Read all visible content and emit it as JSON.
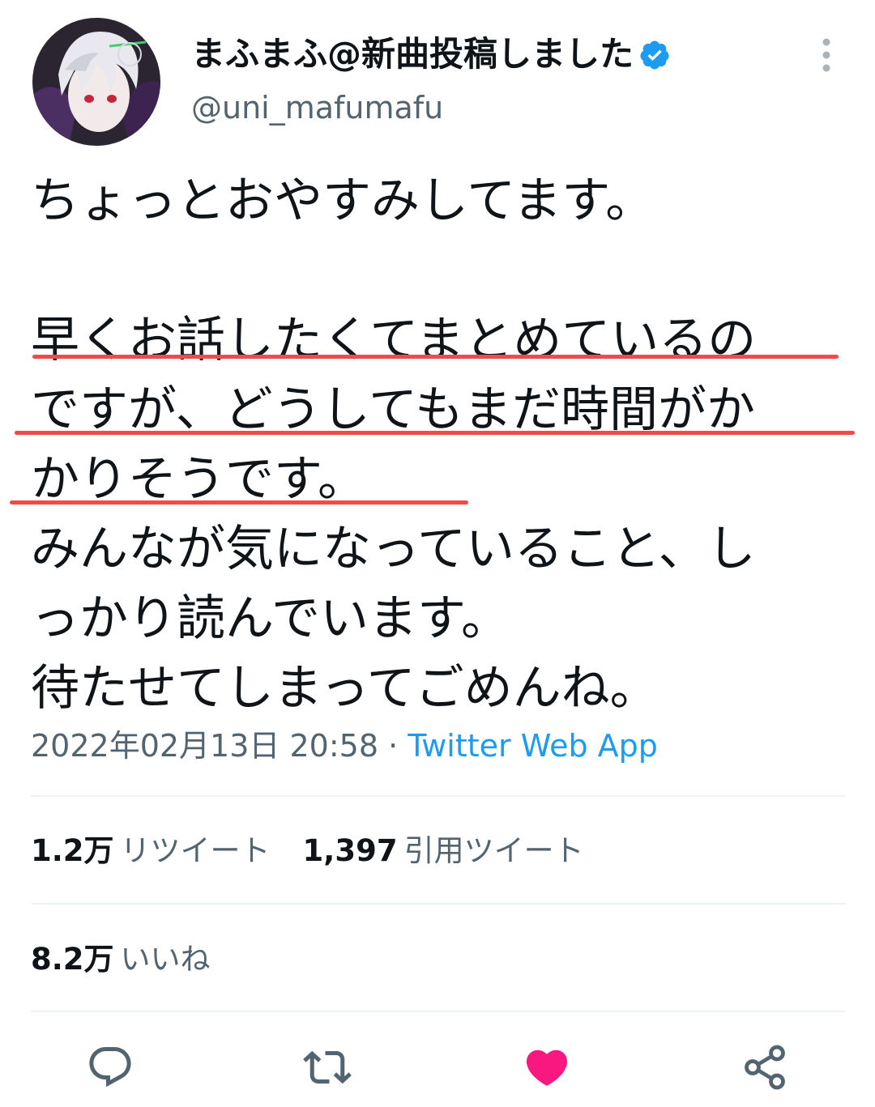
{
  "user": {
    "display_name": "まふまふ@新曲投稿しました",
    "handle": "@uni_mafumafu",
    "verified_icon": "verified-badge-icon",
    "avatar_icon": "avatar-illustration"
  },
  "tweet": {
    "lines": [
      "ちょっとおやすみしてます。",
      "",
      "早くお話したくてまとめているの",
      "ですが、どうしてもまだ時間がか",
      "かりそうです。",
      "みんなが気になっていること、し",
      "っかり読んでいます。",
      "待たせてしまってごめんね。"
    ],
    "timestamp": "2022年02月13日 20:58",
    "separator": "·",
    "source": "Twitter Web App"
  },
  "stats": {
    "retweets_count": "1.2万",
    "retweets_label": "リツイート",
    "quotes_count": "1,397",
    "quotes_label": "引用ツイート",
    "likes_count": "8.2万",
    "likes_label": "いいね"
  },
  "actions": {
    "reply_icon": "reply-icon",
    "retweet_icon": "retweet-icon",
    "like_icon": "heart-icon",
    "share_icon": "share-icon",
    "more_icon": "more-icon"
  },
  "colors": {
    "text": "#0f1419",
    "secondary": "#536471",
    "link": "#1d9bf0",
    "verified": "#1d9bf0",
    "like_active": "#f91880",
    "highlight_underline": "#f04b4b"
  }
}
